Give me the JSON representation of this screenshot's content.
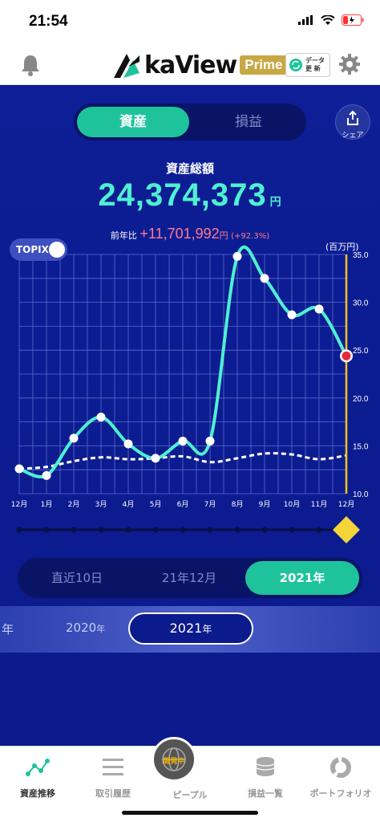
{
  "status_bar": {
    "time": "21:54"
  },
  "header": {
    "logo_text": "kaView",
    "prime_label": "Prime",
    "data_update_label": "データ\n更 新",
    "icons": [
      "bell-icon",
      "gear-icon",
      "refresh-icon"
    ]
  },
  "main": {
    "toggle": {
      "active_label": "資産",
      "inactive_label": "損益"
    },
    "share_label": "シェア",
    "total_label": "資産総額",
    "total_value": "24,374,373",
    "total_unit": "円",
    "yoy_label": "前年比",
    "yoy_value": "+11,701,992",
    "yoy_unit": "円",
    "yoy_pct": "(+92.3%)",
    "topix_label": "TOPIX"
  },
  "chart_data": {
    "type": "line",
    "ylabel": "(百万円)",
    "ylim": [
      10.0,
      35.0
    ],
    "yticks": [
      "35.0",
      "30.0",
      "25.0",
      "20.0",
      "15.0",
      "10.0"
    ],
    "categories": [
      "12月",
      "1月",
      "2月",
      "3月",
      "4月",
      "5月",
      "6月",
      "7月",
      "8月",
      "9月",
      "10月",
      "11月",
      "12月"
    ],
    "series": [
      {
        "name": "",
        "values": [
          12.6,
          11.9,
          15.8,
          18.0,
          15.2,
          13.7,
          15.5,
          15.5,
          34.8,
          32.5,
          28.7,
          29.3,
          24.4
        ],
        "color": "#4ff0d0"
      },
      {
        "name": "TOPIX",
        "values": [
          12.6,
          12.8,
          13.4,
          13.8,
          13.6,
          13.7,
          13.9,
          13.3,
          13.7,
          14.2,
          14.1,
          13.6,
          14.0
        ],
        "color": "#ffffff"
      }
    ],
    "grid": true
  },
  "range_tabs": [
    {
      "label": "直近10日",
      "active": false
    },
    {
      "label": "21年12月",
      "active": false
    },
    {
      "label": "2021年",
      "active": true
    }
  ],
  "year_strip": {
    "left_partial": "年",
    "prev_year": "2020",
    "prev_suffix": "年",
    "current_year": "2021",
    "current_suffix": "年"
  },
  "tabbar": [
    {
      "label": "資産推移",
      "icon": "chart-line-icon",
      "active": true
    },
    {
      "label": "取引履歴",
      "icon": "list-icon",
      "active": false
    },
    {
      "label": "ピープル",
      "icon": "globe-icon",
      "active": false,
      "badge": "開発中"
    },
    {
      "label": "損益一覧",
      "icon": "coins-icon",
      "active": false
    },
    {
      "label": "ポートフォリオ",
      "icon": "donut-icon",
      "active": false
    }
  ]
}
